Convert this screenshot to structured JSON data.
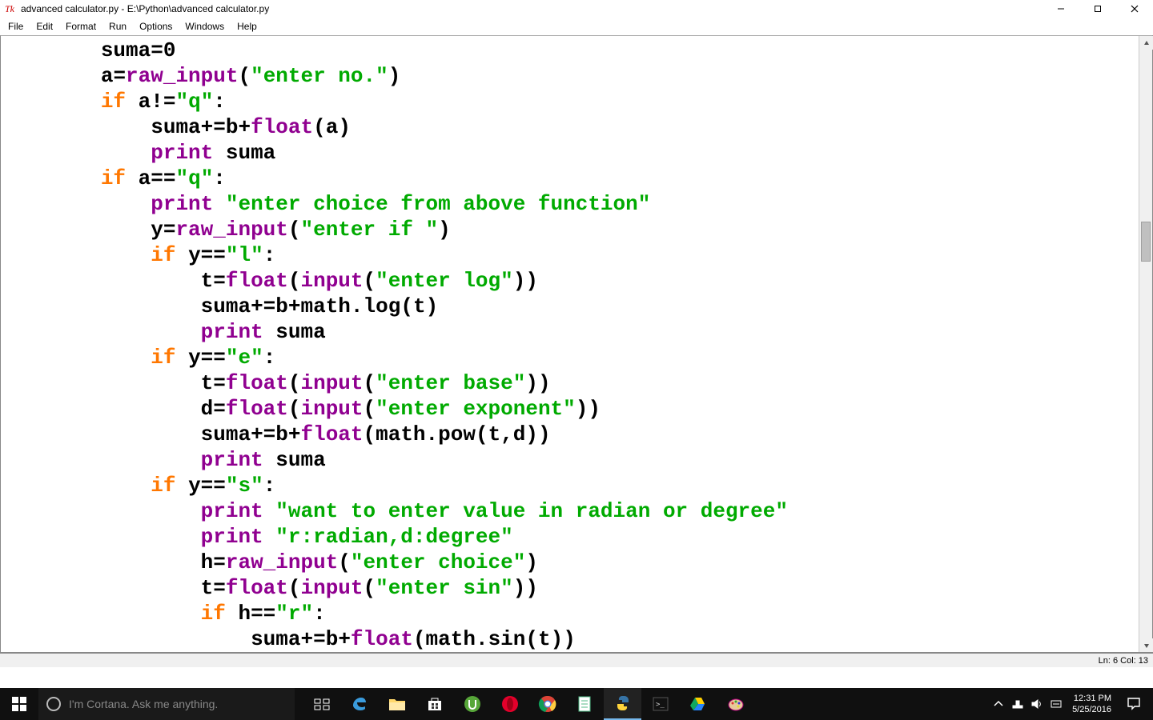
{
  "title": "advanced calculator.py - E:\\Python\\advanced calculator.py",
  "menu": [
    "File",
    "Edit",
    "Format",
    "Run",
    "Options",
    "Windows",
    "Help"
  ],
  "status": "Ln: 6 Col: 13",
  "clock": {
    "time": "12:31 PM",
    "date": "5/25/2016"
  },
  "cortana_placeholder": "I'm Cortana. Ask me anything.",
  "code": [
    [
      [
        "sp",
        "        "
      ],
      [
        "name",
        "suma"
      ],
      [
        "op",
        "="
      ],
      [
        "num",
        "0"
      ]
    ],
    [
      [
        "sp",
        "        "
      ],
      [
        "name",
        "a"
      ],
      [
        "op",
        "="
      ],
      [
        "builtin",
        "raw_input"
      ],
      [
        "op",
        "("
      ],
      [
        "str",
        "\"enter no.\""
      ],
      [
        "op",
        ")"
      ]
    ],
    [
      [
        "sp",
        "        "
      ],
      [
        "kw",
        "if"
      ],
      [
        "sp",
        " "
      ],
      [
        "name",
        "a"
      ],
      [
        "op",
        "!="
      ],
      [
        "str",
        "\"q\""
      ],
      [
        "op",
        ":"
      ]
    ],
    [
      [
        "sp",
        "            "
      ],
      [
        "name",
        "suma"
      ],
      [
        "op",
        "+="
      ],
      [
        "name",
        "b"
      ],
      [
        "op",
        "+"
      ],
      [
        "builtin",
        "float"
      ],
      [
        "op",
        "("
      ],
      [
        "name",
        "a"
      ],
      [
        "op",
        ")"
      ]
    ],
    [
      [
        "sp",
        "            "
      ],
      [
        "print",
        "print"
      ],
      [
        "sp",
        " "
      ],
      [
        "name",
        "suma"
      ]
    ],
    [
      [
        "sp",
        "        "
      ],
      [
        "kw",
        "if"
      ],
      [
        "sp",
        " "
      ],
      [
        "name",
        "a"
      ],
      [
        "op",
        "=="
      ],
      [
        "str",
        "\"q\""
      ],
      [
        "op",
        ":"
      ]
    ],
    [
      [
        "sp",
        "            "
      ],
      [
        "print",
        "print"
      ],
      [
        "sp",
        " "
      ],
      [
        "str",
        "\"enter choice from above function\""
      ]
    ],
    [
      [
        "sp",
        "            "
      ],
      [
        "name",
        "y"
      ],
      [
        "op",
        "="
      ],
      [
        "builtin",
        "raw_input"
      ],
      [
        "op",
        "("
      ],
      [
        "str",
        "\"enter if \""
      ],
      [
        "op",
        ")"
      ]
    ],
    [
      [
        "sp",
        "            "
      ],
      [
        "kw",
        "if"
      ],
      [
        "sp",
        " "
      ],
      [
        "name",
        "y"
      ],
      [
        "op",
        "=="
      ],
      [
        "str",
        "\"l\""
      ],
      [
        "op",
        ":"
      ]
    ],
    [
      [
        "sp",
        "                "
      ],
      [
        "name",
        "t"
      ],
      [
        "op",
        "="
      ],
      [
        "builtin",
        "float"
      ],
      [
        "op",
        "("
      ],
      [
        "builtin",
        "input"
      ],
      [
        "op",
        "("
      ],
      [
        "str",
        "\"enter log\""
      ],
      [
        "op",
        "))"
      ]
    ],
    [
      [
        "sp",
        "                "
      ],
      [
        "name",
        "suma"
      ],
      [
        "op",
        "+="
      ],
      [
        "name",
        "b"
      ],
      [
        "op",
        "+"
      ],
      [
        "name",
        "math"
      ],
      [
        "op",
        "."
      ],
      [
        "name",
        "log"
      ],
      [
        "op",
        "("
      ],
      [
        "name",
        "t"
      ],
      [
        "op",
        ")"
      ]
    ],
    [
      [
        "sp",
        "                "
      ],
      [
        "print",
        "print"
      ],
      [
        "sp",
        " "
      ],
      [
        "name",
        "suma"
      ]
    ],
    [
      [
        "sp",
        "            "
      ],
      [
        "kw",
        "if"
      ],
      [
        "sp",
        " "
      ],
      [
        "name",
        "y"
      ],
      [
        "op",
        "=="
      ],
      [
        "str",
        "\"e\""
      ],
      [
        "op",
        ":"
      ]
    ],
    [
      [
        "sp",
        "                "
      ],
      [
        "name",
        "t"
      ],
      [
        "op",
        "="
      ],
      [
        "builtin",
        "float"
      ],
      [
        "op",
        "("
      ],
      [
        "builtin",
        "input"
      ],
      [
        "op",
        "("
      ],
      [
        "str",
        "\"enter base\""
      ],
      [
        "op",
        "))"
      ]
    ],
    [
      [
        "sp",
        "                "
      ],
      [
        "name",
        "d"
      ],
      [
        "op",
        "="
      ],
      [
        "builtin",
        "float"
      ],
      [
        "op",
        "("
      ],
      [
        "builtin",
        "input"
      ],
      [
        "op",
        "("
      ],
      [
        "str",
        "\"enter exponent\""
      ],
      [
        "op",
        "))"
      ]
    ],
    [
      [
        "sp",
        "                "
      ],
      [
        "name",
        "suma"
      ],
      [
        "op",
        "+="
      ],
      [
        "name",
        "b"
      ],
      [
        "op",
        "+"
      ],
      [
        "builtin",
        "float"
      ],
      [
        "op",
        "("
      ],
      [
        "name",
        "math"
      ],
      [
        "op",
        "."
      ],
      [
        "name",
        "pow"
      ],
      [
        "op",
        "("
      ],
      [
        "name",
        "t"
      ],
      [
        "op",
        ","
      ],
      [
        "name",
        "d"
      ],
      [
        "op",
        "))"
      ]
    ],
    [
      [
        "sp",
        "                "
      ],
      [
        "print",
        "print"
      ],
      [
        "sp",
        " "
      ],
      [
        "name",
        "suma"
      ]
    ],
    [
      [
        "sp",
        "            "
      ],
      [
        "kw",
        "if"
      ],
      [
        "sp",
        " "
      ],
      [
        "name",
        "y"
      ],
      [
        "op",
        "=="
      ],
      [
        "str",
        "\"s\""
      ],
      [
        "op",
        ":"
      ]
    ],
    [
      [
        "sp",
        "                "
      ],
      [
        "print",
        "print"
      ],
      [
        "sp",
        " "
      ],
      [
        "str",
        "\"want to enter value in radian or degree\""
      ]
    ],
    [
      [
        "sp",
        "                "
      ],
      [
        "print",
        "print"
      ],
      [
        "sp",
        " "
      ],
      [
        "str",
        "\"r:radian,d:degree\""
      ]
    ],
    [
      [
        "sp",
        "                "
      ],
      [
        "name",
        "h"
      ],
      [
        "op",
        "="
      ],
      [
        "builtin",
        "raw_input"
      ],
      [
        "op",
        "("
      ],
      [
        "str",
        "\"enter choice\""
      ],
      [
        "op",
        ")"
      ]
    ],
    [
      [
        "sp",
        "                "
      ],
      [
        "name",
        "t"
      ],
      [
        "op",
        "="
      ],
      [
        "builtin",
        "float"
      ],
      [
        "op",
        "("
      ],
      [
        "builtin",
        "input"
      ],
      [
        "op",
        "("
      ],
      [
        "str",
        "\"enter sin\""
      ],
      [
        "op",
        "))"
      ]
    ],
    [
      [
        "sp",
        "                "
      ],
      [
        "kw",
        "if"
      ],
      [
        "sp",
        " "
      ],
      [
        "name",
        "h"
      ],
      [
        "op",
        "=="
      ],
      [
        "str",
        "\"r\""
      ],
      [
        "op",
        ":"
      ]
    ],
    [
      [
        "sp",
        "                    "
      ],
      [
        "name",
        "suma"
      ],
      [
        "op",
        "+="
      ],
      [
        "name",
        "b"
      ],
      [
        "op",
        "+"
      ],
      [
        "builtin",
        "float"
      ],
      [
        "op",
        "("
      ],
      [
        "name",
        "math"
      ],
      [
        "op",
        "."
      ],
      [
        "name",
        "sin"
      ],
      [
        "op",
        "("
      ],
      [
        "name",
        "t"
      ],
      [
        "op",
        "))"
      ]
    ]
  ],
  "taskbar_icons": [
    "task-view-icon",
    "edge-icon",
    "file-explorer-icon",
    "store-icon",
    "utorrent-icon",
    "opera-icon",
    "chrome-icon",
    "notepadpp-icon",
    "idle-icon",
    "cmd-icon",
    "drive-icon",
    "paint-icon"
  ]
}
